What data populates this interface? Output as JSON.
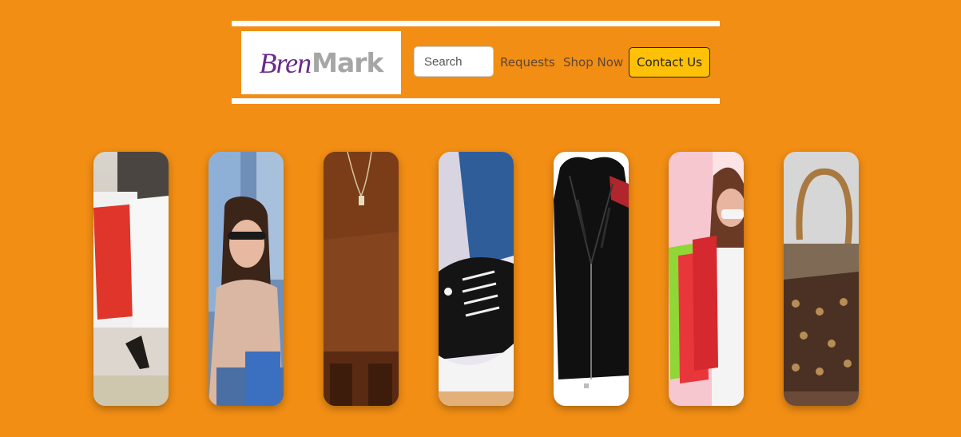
{
  "header": {
    "logo": {
      "part1": "Bren",
      "part2": "Mark"
    },
    "search": {
      "placeholder": "Search",
      "value": ""
    },
    "nav": {
      "requests": "Requests",
      "shop_now": "Shop Now",
      "contact": "Contact Us"
    }
  },
  "gallery": {
    "items": [
      {
        "subject": "shopping bags"
      },
      {
        "subject": "woman with sunglasses"
      },
      {
        "subject": "brown outfit"
      },
      {
        "subject": "black sneakers"
      },
      {
        "subject": "leather jacket"
      },
      {
        "subject": "woman with shopping bags"
      },
      {
        "subject": "monogram handbag"
      }
    ]
  },
  "colors": {
    "background": "#f28e14",
    "accent": "#ffc107",
    "logo_purple": "#6a2a8a",
    "logo_gray": "#a6a6a6"
  }
}
